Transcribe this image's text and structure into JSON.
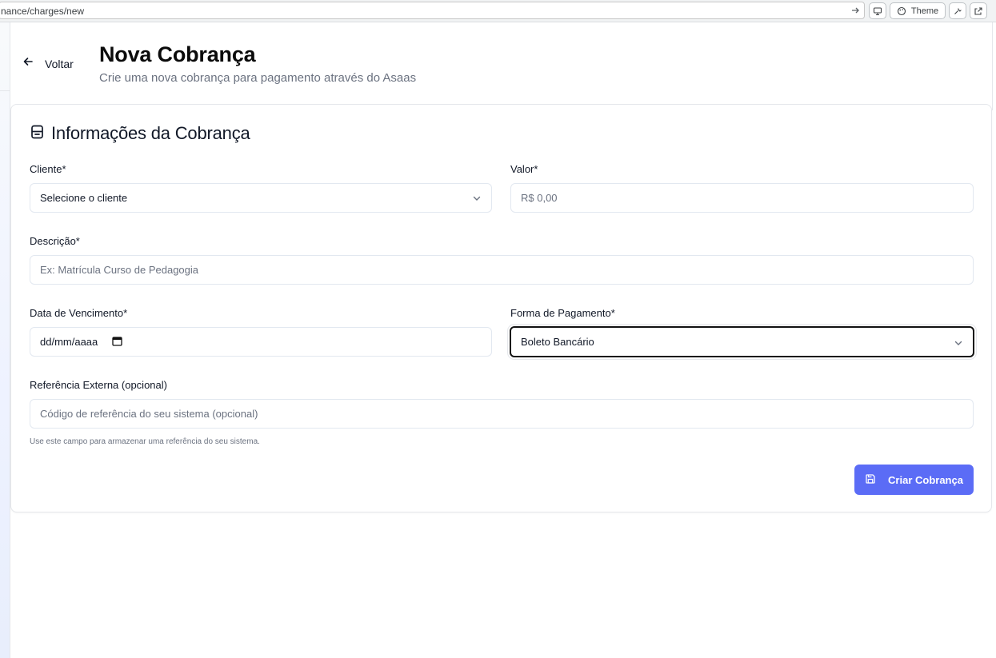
{
  "browser": {
    "url": "nance/charges/new",
    "theme_label": "Theme"
  },
  "header": {
    "back_label": "Voltar",
    "title": "Nova Cobrança",
    "subtitle": "Crie uma nova cobrança para pagamento através do Asaas"
  },
  "card": {
    "title": "Informações da Cobrança",
    "client": {
      "label": "Cliente*",
      "value": "Selecione o cliente"
    },
    "amount": {
      "label": "Valor*",
      "placeholder": "R$ 0,00"
    },
    "description": {
      "label": "Descrição*",
      "placeholder": "Ex: Matrícula Curso de Pedagogia"
    },
    "due_date": {
      "label": "Data de Vencimento*",
      "value": "dd/mm/aaaa"
    },
    "payment_method": {
      "label": "Forma de Pagamento*",
      "value": "Boleto Bancário"
    },
    "external_ref": {
      "label": "Referência Externa (opcional)",
      "placeholder": "Código de referência do seu sistema (opcional)",
      "hint": "Use este campo para armazenar uma referência do seu sistema."
    },
    "submit_label": "Criar Cobrança"
  },
  "colors": {
    "accent": "#5b6cf6",
    "title": "#0b0b0b",
    "muted": "#6b7280",
    "border": "#e2e8f0"
  },
  "icons": [
    "arrow-left-icon",
    "receipt-icon",
    "chevron-down-icon",
    "calendar-icon",
    "save-icon",
    "monitor-icon",
    "palette-icon",
    "wrench-icon",
    "external-link-icon",
    "arrow-right-icon"
  ]
}
